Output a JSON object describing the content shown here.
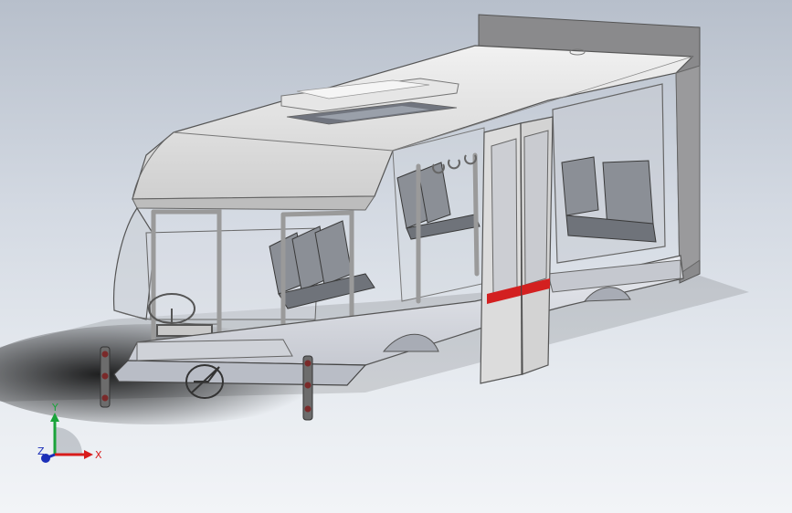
{
  "viewport": {
    "background_top": "#b7bfcb",
    "background_bottom": "#f2f4f7"
  },
  "triad": {
    "x_label": "X",
    "y_label": "Y",
    "z_label": "Z",
    "x_color": "#d81b1b",
    "y_color": "#1aa33a",
    "z_color": "#1c2fb8"
  },
  "model": {
    "door_stripe_color": "#d32020",
    "light_color": "#7a2a2a"
  }
}
